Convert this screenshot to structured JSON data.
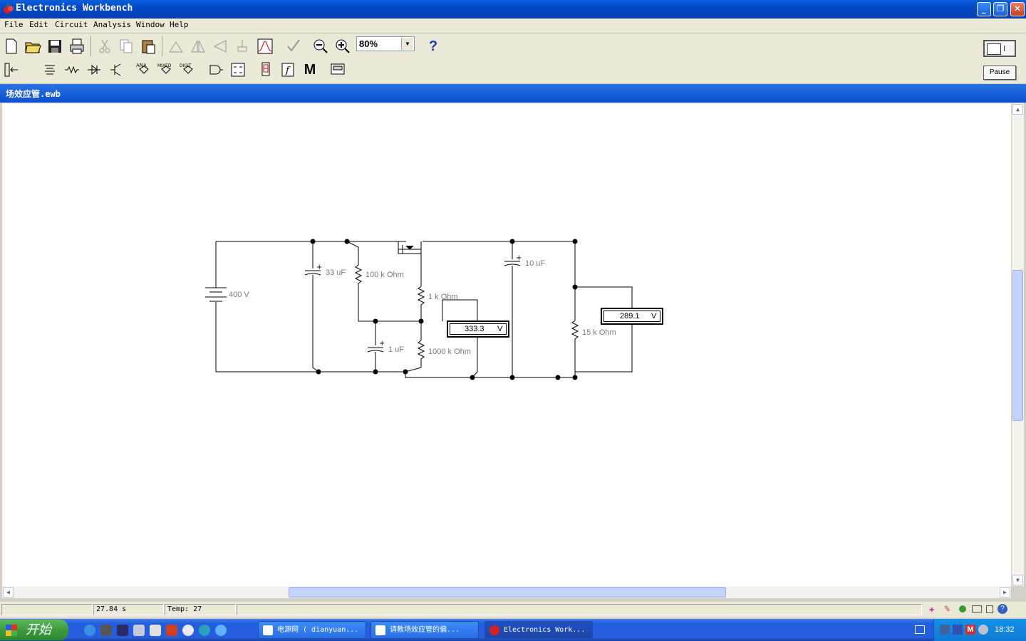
{
  "window": {
    "title": "Electronics Workbench"
  },
  "menu": [
    "File",
    "Edit",
    "Circuit",
    "Analysis",
    "Window",
    "Help"
  ],
  "toolbar": {
    "zoom_value": "80%",
    "help_label": "?",
    "pause_label": "Pause",
    "parts_labels": [
      "ANA",
      "MIXED",
      "DIGIT"
    ],
    "m_label": "M"
  },
  "document": {
    "title": "场效应管.ewb"
  },
  "circuit": {
    "battery": "400 V",
    "cap1": "33 uF",
    "res1": "100 k Ohm",
    "res2": "1 k Ohm",
    "cap2": "1 uF",
    "res3": "1000 k Ohm",
    "cap3": "10 uF",
    "res4": "15 k Ohm",
    "voltmeter1": {
      "value": "333.3",
      "unit": "V"
    },
    "voltmeter2": {
      "value": "289.1",
      "unit": "V"
    }
  },
  "status": {
    "time": "27.84 s",
    "temp": "Temp:  27"
  },
  "taskbar": {
    "start_label": "开始",
    "tasks": [
      {
        "label": "电源网 ( dianyuan...",
        "active": false
      },
      {
        "label": "请教场效应管的偏...",
        "active": false
      },
      {
        "label": "Electronics Work...",
        "active": true
      }
    ],
    "clock": "18:32"
  },
  "colors": {
    "titlebar": "#0047c8",
    "menubar": "#ece9d8",
    "canvas": "#ffffff",
    "taskbar": "#245edc",
    "start_button": "#3c9a3c",
    "wire": "#000000",
    "label": "#7a7a7a"
  }
}
